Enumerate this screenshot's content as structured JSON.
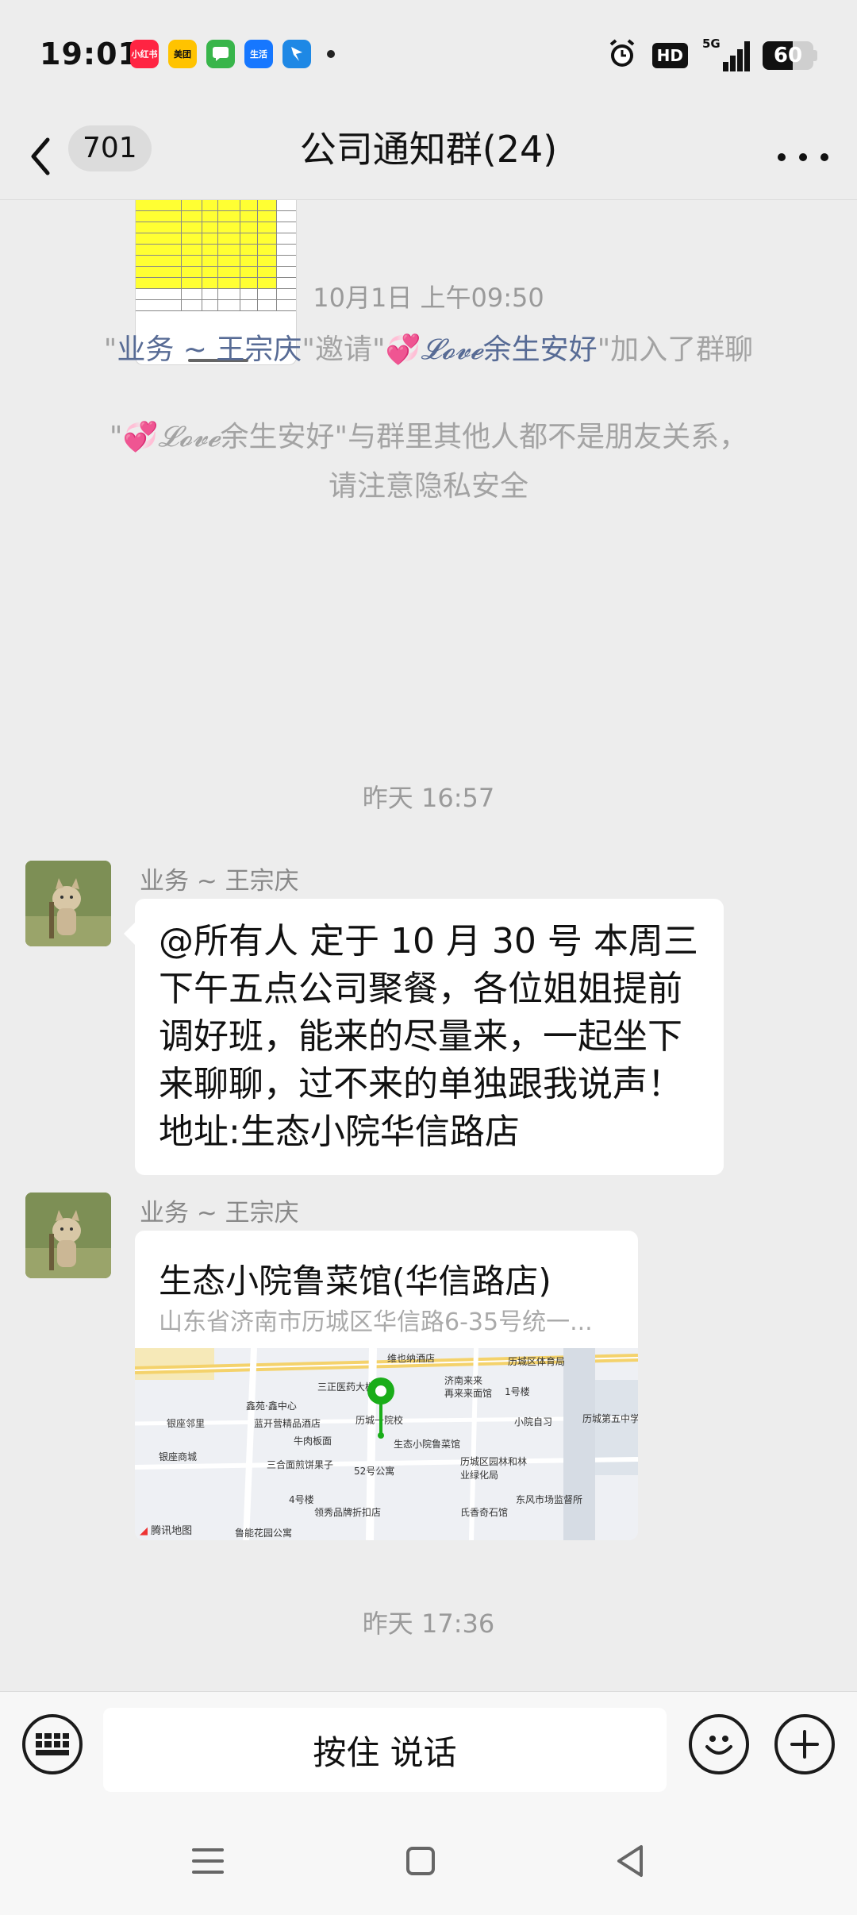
{
  "status_bar": {
    "time": "19:01",
    "apps": [
      {
        "name": "xiaohongshu-icon",
        "label": "小红书",
        "color": "#ff2442"
      },
      {
        "name": "meituan-icon",
        "label": "美团",
        "color": "#ffc300"
      },
      {
        "name": "messages-icon",
        "label": "",
        "color": "#38b54a"
      },
      {
        "name": "life-icon",
        "label": "生活",
        "color": "#1677ff"
      },
      {
        "name": "dingtalk-icon",
        "label": "",
        "color": "#1e88e5"
      }
    ],
    "hd": "HD",
    "network": "5G",
    "battery": "60",
    "battery_level": 60
  },
  "nav": {
    "unread": "701",
    "title": "公司通知群(24)"
  },
  "messages": {
    "time1": "10月1日 上午09:50",
    "sys1": {
      "q1": "\"",
      "inviter": "业务 ~ 王宗庆",
      "invited_mid": "\"邀请\"",
      "heart": "💞",
      "fancy": "𝓛𝓸𝓿𝓮",
      "invitee": "余生安好",
      "tail": "\"加入了群聊"
    },
    "sys2": {
      "q1": "\"",
      "heart": "💞",
      "fancy": "𝓛𝓸𝓿𝓮",
      "name": "余生安好",
      "line1_tail": "\"与群里其他人都不是朋友关系，",
      "line2": "请注意隐私安全"
    },
    "time2": "昨天 16:57",
    "msg1": {
      "sender": "业务 ~ 王宗庆",
      "lines": [
        "@所有人  定于 10 月 30 号 本周三",
        "下午五点公司聚餐，各位姐姐提前",
        "调好班，能来的尽量来，一起坐下",
        "来聊聊，过不来的单独跟我说声！",
        "地址:生态小院华信路店"
      ]
    },
    "msg2": {
      "sender": "业务 ~ 王宗庆",
      "loc_name": "生态小院鲁菜馆(华信路店)",
      "loc_addr": "山东省济南市历城区华信路6-35号统一...",
      "map_labels": [
        "维也纳酒店",
        "历城区体育局",
        "济南来来",
        "再来来面馆",
        "三正医药大楼",
        "鑫苑·鑫中心",
        "蓝开营精品酒店",
        "牛肉板面",
        "银座邻里",
        "银座商城",
        "三合面煎饼果子",
        "小院自习",
        "历城第五中学",
        "生态小院鲁菜馆",
        "52号公寓",
        "历城区园林和林业绿化局",
        "东风市场监督所",
        "氏香奇石馆",
        "领秀品牌折扣店",
        "4号楼",
        "1号楼",
        "历城一院校",
        "鲁能花园公寓"
      ],
      "map_credit": "腾讯地图"
    },
    "time3": "昨天 17:36"
  },
  "input": {
    "hold_to_talk": "按住 说话"
  }
}
